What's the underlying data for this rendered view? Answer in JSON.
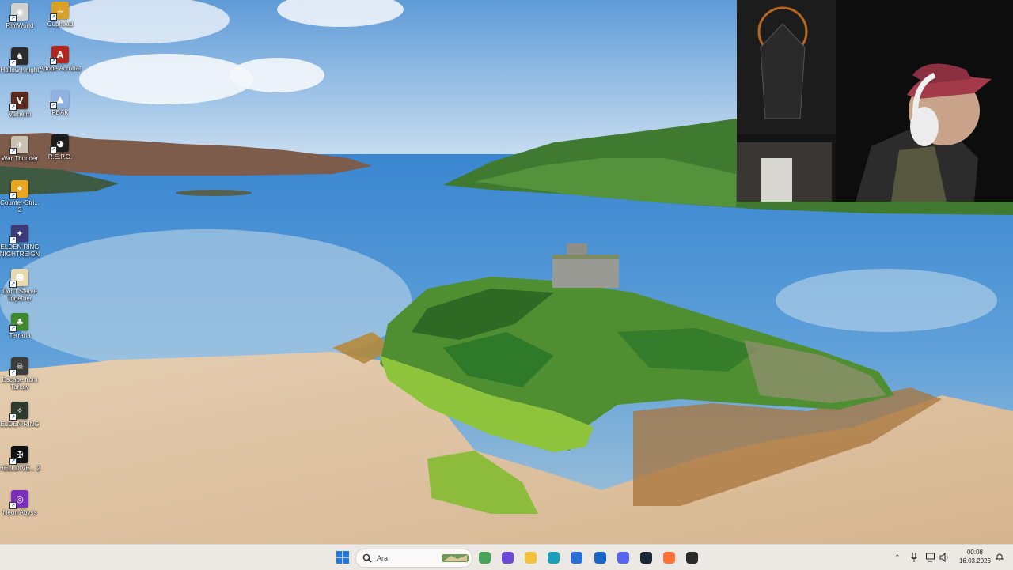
{
  "desktop": {
    "icons_col1": [
      {
        "label": "RimWorld",
        "color": "#d0d0d0",
        "glyph": "◉"
      },
      {
        "label": "Hollow Knight",
        "color": "#2b2b2b",
        "glyph": "♞"
      },
      {
        "label": "Valheim",
        "color": "#5a2a1f",
        "glyph": "V"
      },
      {
        "label": "War Thunder",
        "color": "#c9c2b2",
        "glyph": "✈"
      },
      {
        "label": "Counter-Stri... 2",
        "color": "#e8a623",
        "glyph": "⌖"
      },
      {
        "label": "ELDEN RING NIGHTREIGN",
        "color": "#3c3a78",
        "glyph": "✦"
      },
      {
        "label": "Don't Starve Together",
        "color": "#e6d9b0",
        "glyph": "☻"
      },
      {
        "label": "Terraria",
        "color": "#3f8a2e",
        "glyph": "♣"
      },
      {
        "label": "Escape from Tarkov",
        "color": "#3d3d3d",
        "glyph": "☠"
      },
      {
        "label": "ELDEN RING",
        "color": "#2e3a2e",
        "glyph": "✧"
      },
      {
        "label": "HELLDIVE... 2",
        "color": "#111111",
        "glyph": "✠"
      },
      {
        "label": "Neon Abyss",
        "color": "#7a2fb8",
        "glyph": "◎"
      }
    ],
    "icons_col2": [
      {
        "label": "Cuphead",
        "color": "#d9a024",
        "glyph": "☕"
      },
      {
        "label": "Adobe Acrobat",
        "color": "#b3261e",
        "glyph": "A"
      },
      {
        "label": "PBAK",
        "color": "#8fb0e0",
        "glyph": "▲"
      },
      {
        "label": "R.E.P.O.",
        "color": "#1d1d1d",
        "glyph": "◕"
      }
    ]
  },
  "taskbar": {
    "search_placeholder": "Ara",
    "pinned": [
      {
        "name": "widgets-icon",
        "color": "#4aa35a"
      },
      {
        "name": "copilot-icon",
        "color": "#6c4ad6"
      },
      {
        "name": "file-explorer-icon",
        "color": "#f2c23c"
      },
      {
        "name": "edge-icon",
        "color": "#1aa0b8"
      },
      {
        "name": "store-icon",
        "color": "#2a6fd6"
      },
      {
        "name": "outlook-icon",
        "color": "#1a66c4"
      },
      {
        "name": "discord-icon",
        "color": "#5865f2"
      },
      {
        "name": "steam-icon",
        "color": "#1b2838"
      },
      {
        "name": "firefox-icon",
        "color": "#ff7139"
      },
      {
        "name": "obs-icon",
        "color": "#2a2a2a"
      }
    ],
    "time": "00:08",
    "date": "16.03.2026"
  }
}
